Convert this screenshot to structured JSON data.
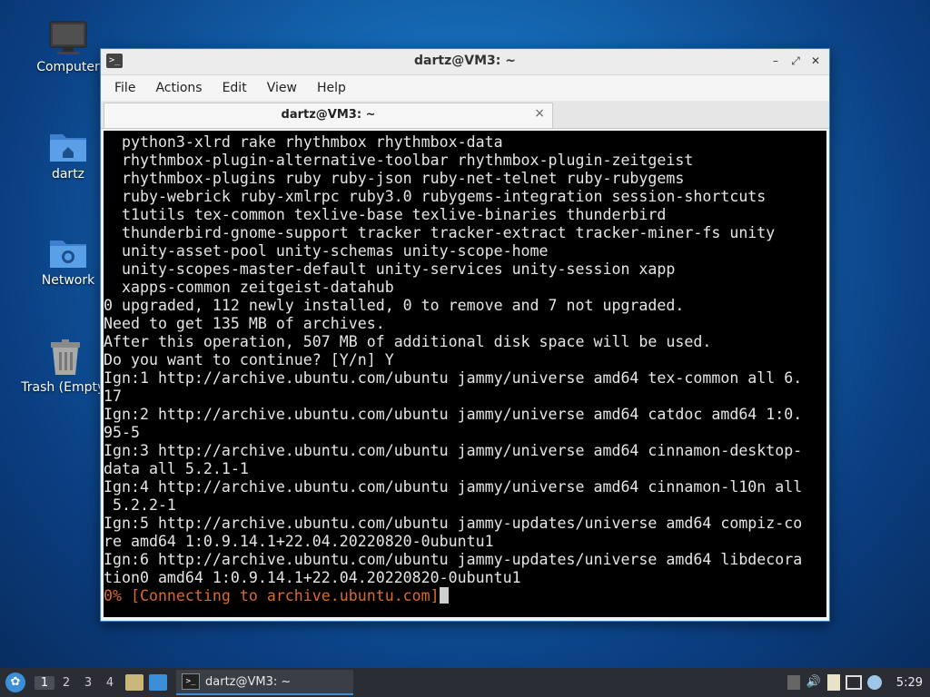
{
  "desktop": {
    "icons": [
      {
        "label": "Computer",
        "icon": "monitor-icon"
      },
      {
        "label": "dartz",
        "icon": "home-folder-icon"
      },
      {
        "label": "Network",
        "icon": "network-folder-icon"
      },
      {
        "label": "Trash (Empty)",
        "icon": "trash-icon"
      }
    ]
  },
  "window": {
    "title": "dartz@VM3: ~",
    "menu": [
      "File",
      "Actions",
      "Edit",
      "View",
      "Help"
    ],
    "tab_title": "dartz@VM3: ~",
    "close_glyph": "×"
  },
  "terminal": {
    "lines": [
      "  python3-xlrd rake rhythmbox rhythmbox-data",
      "  rhythmbox-plugin-alternative-toolbar rhythmbox-plugin-zeitgeist",
      "  rhythmbox-plugins ruby ruby-json ruby-net-telnet ruby-rubygems",
      "  ruby-webrick ruby-xmlrpc ruby3.0 rubygems-integration session-shortcuts",
      "  t1utils tex-common texlive-base texlive-binaries thunderbird",
      "  thunderbird-gnome-support tracker tracker-extract tracker-miner-fs unity",
      "  unity-asset-pool unity-schemas unity-scope-home",
      "  unity-scopes-master-default unity-services unity-session xapp",
      "  xapps-common zeitgeist-datahub",
      "0 upgraded, 112 newly installed, 0 to remove and 7 not upgraded.",
      "Need to get 135 MB of archives.",
      "After this operation, 507 MB of additional disk space will be used.",
      "Do you want to continue? [Y/n] Y",
      "Ign:1 http://archive.ubuntu.com/ubuntu jammy/universe amd64 tex-common all 6.",
      "17",
      "Ign:2 http://archive.ubuntu.com/ubuntu jammy/universe amd64 catdoc amd64 1:0.",
      "95-5",
      "Ign:3 http://archive.ubuntu.com/ubuntu jammy/universe amd64 cinnamon-desktop-",
      "data all 5.2.1-1",
      "Ign:4 http://archive.ubuntu.com/ubuntu jammy/universe amd64 cinnamon-l10n all",
      " 5.2.2-1",
      "Ign:5 http://archive.ubuntu.com/ubuntu jammy-updates/universe amd64 compiz-co",
      "re amd64 1:0.9.14.1+22.04.20220820-0ubuntu1",
      "Ign:6 http://archive.ubuntu.com/ubuntu jammy-updates/universe amd64 libdecora",
      "tion0 amd64 1:0.9.14.1+22.04.20220820-0ubuntu1"
    ],
    "status_line": "0% [Connecting to archive.ubuntu.com]",
    "status_color": "#d96a2c"
  },
  "taskbar": {
    "workspaces": [
      "1",
      "2",
      "3",
      "4"
    ],
    "active_workspace": "1",
    "task_label": "dartz@VM3: ~",
    "clock": "5:29"
  }
}
